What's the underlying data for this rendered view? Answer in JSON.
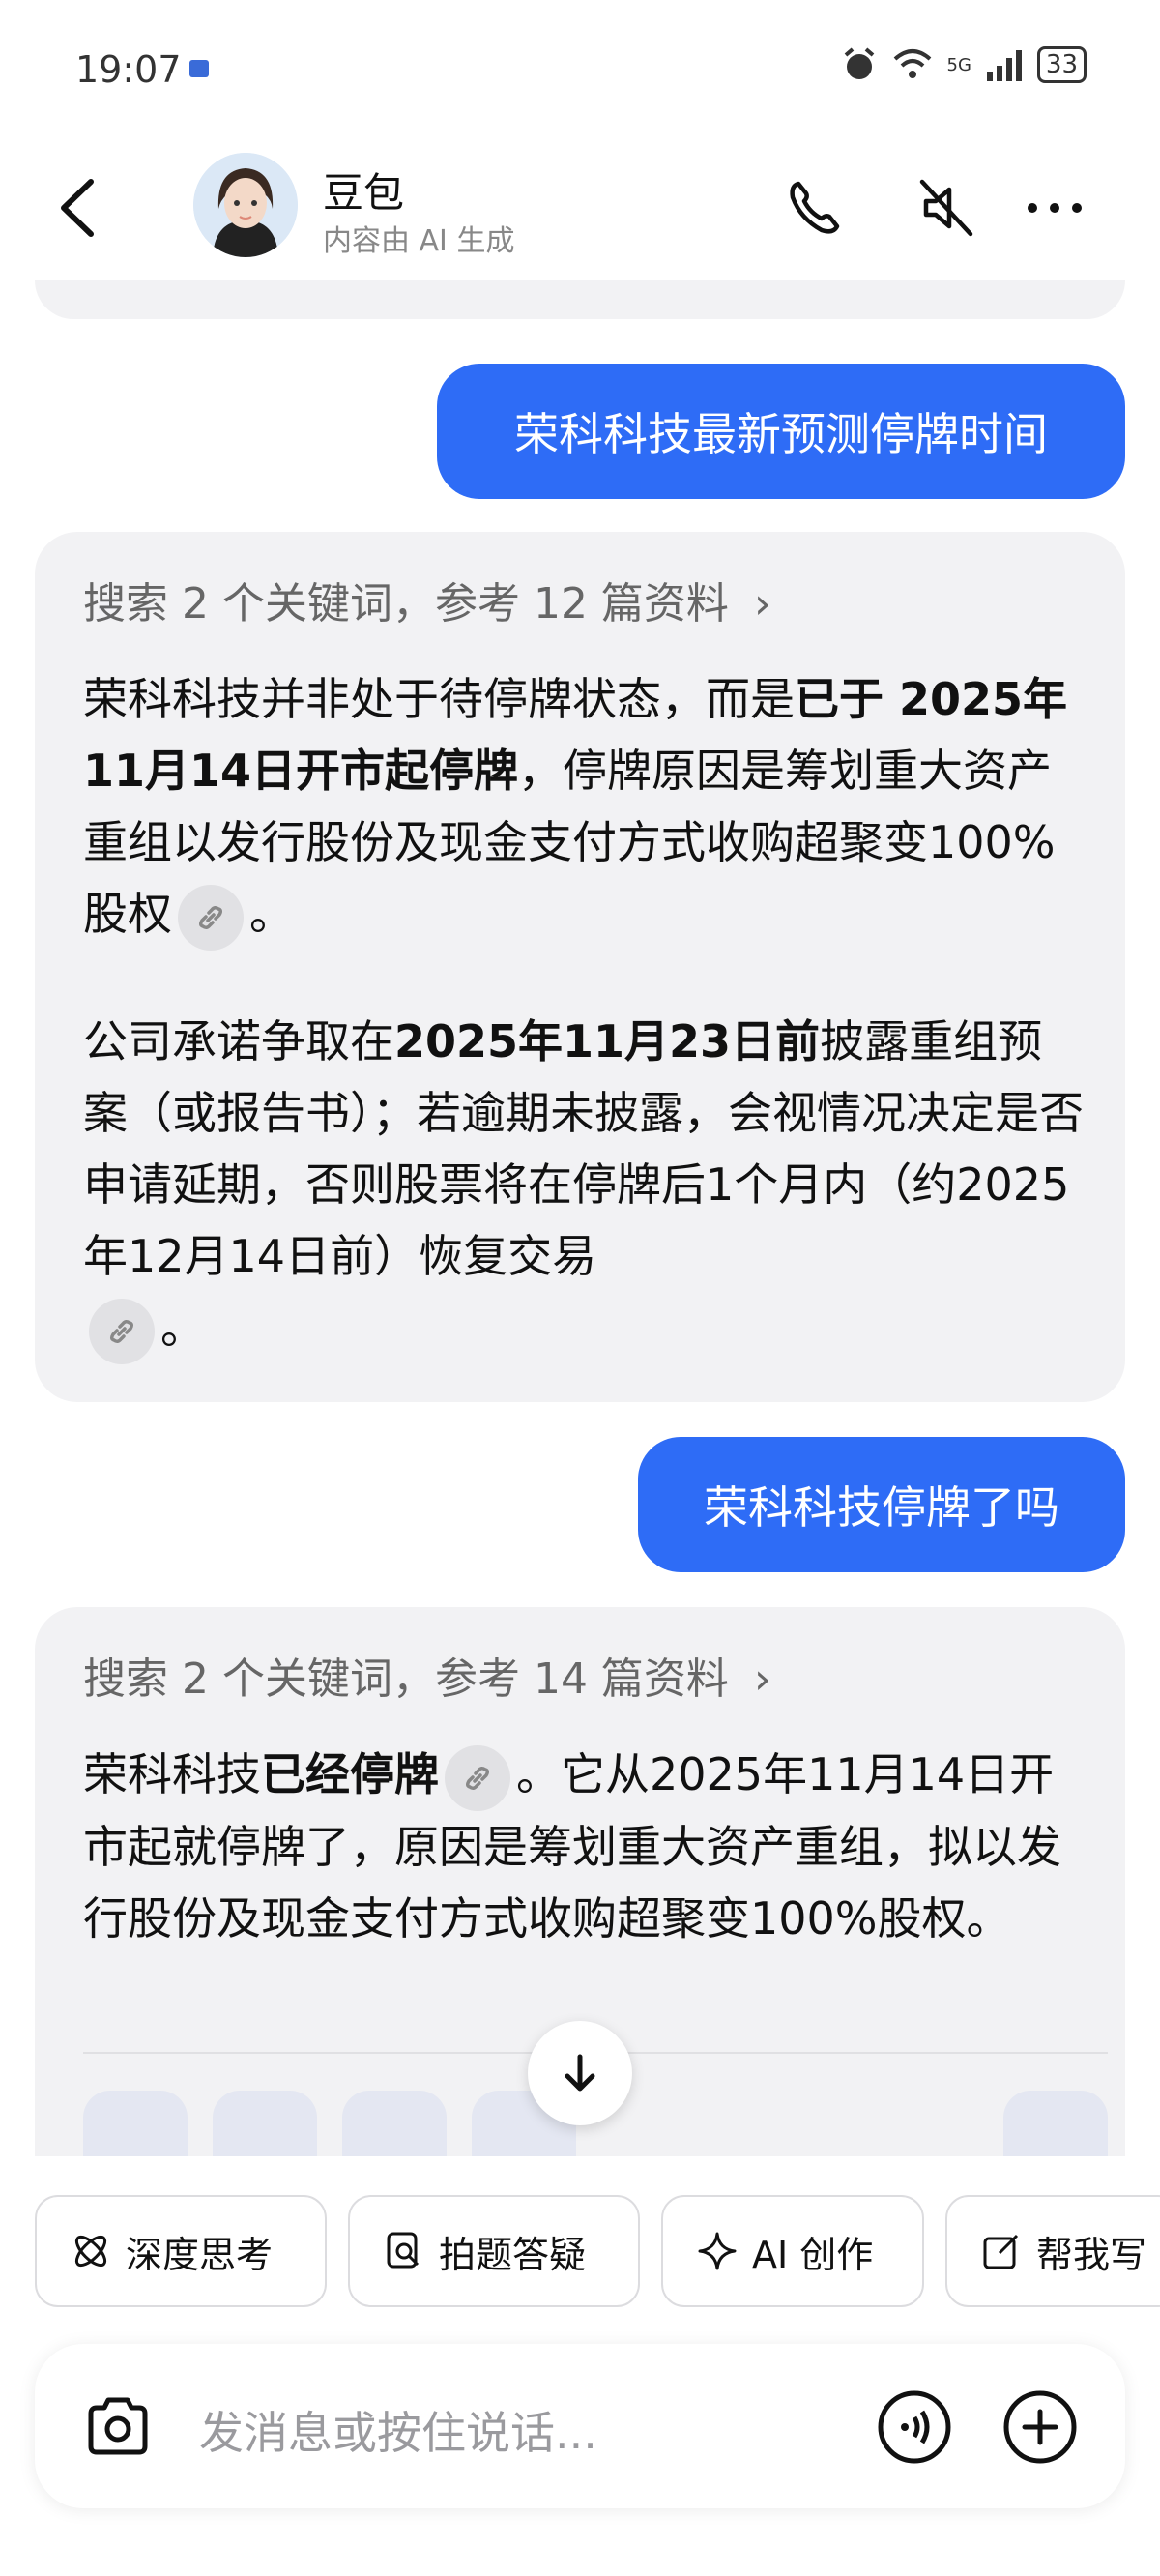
{
  "status_bar": {
    "time": "19:07",
    "network": "5G",
    "battery": "33"
  },
  "header": {
    "title": "豆包",
    "subtitle": "内容由 AI 生成"
  },
  "messages": [
    {
      "role": "user",
      "text": "荣科科技最新预测停牌时间"
    },
    {
      "role": "ai",
      "search_summary": "搜索 2 个关键词，参考 12 篇资料",
      "para1": {
        "a": "荣科科技并非处于待停牌状态，而是",
        "b": "已于 2025年11月14日开市起停牌",
        "c": "，停牌原因是筹划重大资产重组以发行股份及现金支付方式收购超聚变100%股权",
        "d": "。"
      },
      "para2": {
        "a": "公司承诺争取在",
        "b": "2025年11月23日前",
        "c": "披露重组预案（或报告书）；若逾期未披露，会视情况决定是否申请延期，否则股票将在停牌后1个月内（约2025年12月14日前）恢复交易",
        "d": "。"
      }
    },
    {
      "role": "user",
      "text": "荣科科技停牌了吗"
    },
    {
      "role": "ai",
      "search_summary": "搜索 2 个关键词，参考 14 篇资料",
      "para1": {
        "a": "荣科科技",
        "b": "已经停牌",
        "c": "。它从2025年11月14日开市起就停牌了，原因是筹划重大资产重组，拟以发行股份及现金支付方式收购超聚变100%股权。"
      }
    }
  ],
  "quick_actions": [
    {
      "label": "深度思考",
      "icon": "atom-icon"
    },
    {
      "label": "拍题答疑",
      "icon": "photo-search-icon"
    },
    {
      "label": "AI 创作",
      "icon": "sparkle-icon"
    },
    {
      "label": "帮我写",
      "icon": "edit-icon"
    }
  ],
  "input": {
    "placeholder": "发消息或按住说话..."
  },
  "colors": {
    "accent": "#2e6cf6",
    "card_bg": "#f2f2f4"
  }
}
